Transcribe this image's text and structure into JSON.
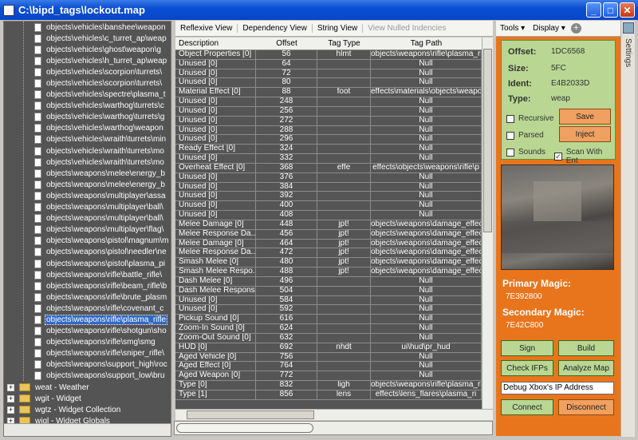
{
  "window": {
    "title": "C:\\bipd_tags\\lockout.map"
  },
  "tree": {
    "tag_items": [
      "objects\\vehicles\\banshee\\weapon",
      "objects\\vehicles\\c_turret_ap\\weap",
      "objects\\vehicles\\ghost\\weapon\\g",
      "objects\\vehicles\\h_turret_ap\\weap",
      "objects\\vehicles\\scorpion\\turrets\\",
      "objects\\vehicles\\scorpion\\turrets\\",
      "objects\\vehicles\\spectre\\plasma_t",
      "objects\\vehicles\\warthog\\turrets\\c",
      "objects\\vehicles\\warthog\\turrets\\g",
      "objects\\vehicles\\warthog\\weapon",
      "objects\\vehicles\\wraith\\turrets\\min",
      "objects\\vehicles\\wraith\\turrets\\mo",
      "objects\\vehicles\\wraith\\turrets\\mo",
      "objects\\weapons\\melee\\energy_b",
      "objects\\weapons\\melee\\energy_b",
      "objects\\weapons\\multiplayer\\assa",
      "objects\\weapons\\multiplayer\\ball\\",
      "objects\\weapons\\multiplayer\\ball\\",
      "objects\\weapons\\multiplayer\\flag\\",
      "objects\\weapons\\pistol\\magnum\\m",
      "objects\\weapons\\pistol\\needler\\ne",
      "objects\\weapons\\pistol\\plasma_pi",
      "objects\\weapons\\rifle\\battle_rifle\\",
      "objects\\weapons\\rifle\\beam_rifle\\b",
      "objects\\weapons\\rifle\\brute_plasm",
      "objects\\weapons\\rifle\\covenant_c",
      "objects\\weapons\\rifle\\plasma_rifle",
      "objects\\weapons\\rifle\\shotgun\\sho",
      "objects\\weapons\\rifle\\smg\\smg",
      "objects\\weapons\\rifle\\sniper_rifle\\",
      "objects\\weapons\\support_high\\roc",
      "objects\\weapons\\support_low\\bru"
    ],
    "selected_index": 26,
    "groups": [
      "weat - Weather",
      "wgit - Widget",
      "wgtz - Widget Collection",
      "wigl - Widget Globals"
    ]
  },
  "toolbar": {
    "reflexive": "Reflexive View",
    "dependency": "Dependency View",
    "string": "String View",
    "nulled": "View Nulled Indencies"
  },
  "grid": {
    "headers": [
      "Description",
      "Offset",
      "Tag Type",
      "Tag Path"
    ],
    "rows": [
      [
        "Object Properties [0]",
        "56",
        "hlmt",
        "objects\\weapons\\rifle\\plasma_ri"
      ],
      [
        "Unused [0]",
        "64",
        "",
        "Null"
      ],
      [
        "Unused [0]",
        "72",
        "",
        "Null"
      ],
      [
        "Unused [0]",
        "80",
        "",
        "Null"
      ],
      [
        "Material Effect [0]",
        "88",
        "foot",
        "effects\\materials\\objects\\weapo"
      ],
      [
        "Unused [0]",
        "248",
        "",
        "Null"
      ],
      [
        "Unused [0]",
        "256",
        "",
        "Null"
      ],
      [
        "Unused [0]",
        "272",
        "",
        "Null"
      ],
      [
        "Unused [0]",
        "288",
        "",
        "Null"
      ],
      [
        "Unused [0]",
        "296",
        "",
        "Null"
      ],
      [
        "Ready Effect [0]",
        "324",
        "",
        "Null"
      ],
      [
        "Unused [0]",
        "332",
        "",
        "Null"
      ],
      [
        "Overheat Effect [0]",
        "368",
        "effe",
        "effects\\objects\\weapons\\rifle\\p"
      ],
      [
        "Unused [0]",
        "376",
        "",
        "Null"
      ],
      [
        "Unused [0]",
        "384",
        "",
        "Null"
      ],
      [
        "Unused [0]",
        "392",
        "",
        "Null"
      ],
      [
        "Unused [0]",
        "400",
        "",
        "Null"
      ],
      [
        "Unused [0]",
        "408",
        "",
        "Null"
      ],
      [
        "Melee Damage [0]",
        "448",
        "jpt!",
        "objects\\weapons\\damage_effec"
      ],
      [
        "Melee Response Da...",
        "456",
        "jpt!",
        "objects\\weapons\\damage_effec"
      ],
      [
        "Melee Damage [0]",
        "464",
        "jpt!",
        "objects\\weapons\\damage_effec"
      ],
      [
        "Melee Response Da...",
        "472",
        "jpt!",
        "objects\\weapons\\damage_effec"
      ],
      [
        "Smash Melee [0]",
        "480",
        "jpt!",
        "objects\\weapons\\damage_effec"
      ],
      [
        "Smash Melee Respo...",
        "488",
        "jpt!",
        "objects\\weapons\\damage_effec"
      ],
      [
        "Dash Melee [0]",
        "496",
        "",
        "Null"
      ],
      [
        "Dash Melee Respons...",
        "504",
        "",
        "Null"
      ],
      [
        "Unused [0]",
        "584",
        "",
        "Null"
      ],
      [
        "Unused [0]",
        "592",
        "",
        "Null"
      ],
      [
        "Pickup Sound [0]",
        "616",
        "",
        "Null"
      ],
      [
        "Zoom-In Sound [0]",
        "624",
        "",
        "Null"
      ],
      [
        "Zoom-Out Sound [0]",
        "632",
        "",
        "Null"
      ],
      [
        "HUD [0]",
        "692",
        "nhdt",
        "ui\\hud\\pr_hud"
      ],
      [
        "Aged Vehicle [0]",
        "756",
        "",
        "Null"
      ],
      [
        "Aged Effect [0]",
        "764",
        "",
        "Null"
      ],
      [
        "Aged Weapon [0]",
        "772",
        "",
        "Null"
      ],
      [
        "Type [0]",
        "832",
        "ligh",
        "objects\\weapons\\rifle\\plasma_ri"
      ],
      [
        "Type [1]",
        "856",
        "lens",
        "effects\\lens_flares\\plasma_ri"
      ]
    ]
  },
  "right_toolbar": {
    "tools": "Tools",
    "display": "Display"
  },
  "info": {
    "offset_label": "Offset:",
    "offset": "1DC6568",
    "size_label": "Size:",
    "size": "5FC",
    "ident_label": "Ident:",
    "ident": "E4B2033D",
    "type_label": "Type:",
    "type": "weap",
    "recursive": "Recursive",
    "parsed": "Parsed",
    "sounds": "Sounds",
    "scan": "Scan With Ent",
    "save": "Save",
    "inject": "Inject"
  },
  "magic": {
    "primary_label": "Primary Magic:",
    "primary": "7E392800",
    "secondary_label": "Secondary Magic:",
    "secondary": "7E42C800"
  },
  "actions": {
    "sign": "Sign",
    "build": "Build",
    "check_ifps": "Check IFPs",
    "analyze": "Analyze Map",
    "ip_value": "Debug  Xbox's  IP  Address",
    "connect": "Connect",
    "disconnect": "Disconnect"
  },
  "settings_tab": "Settings",
  "colors": {
    "accent_orange": "#e8751c",
    "info_green": "#b9d793",
    "selection_blue": "#3169c6"
  }
}
